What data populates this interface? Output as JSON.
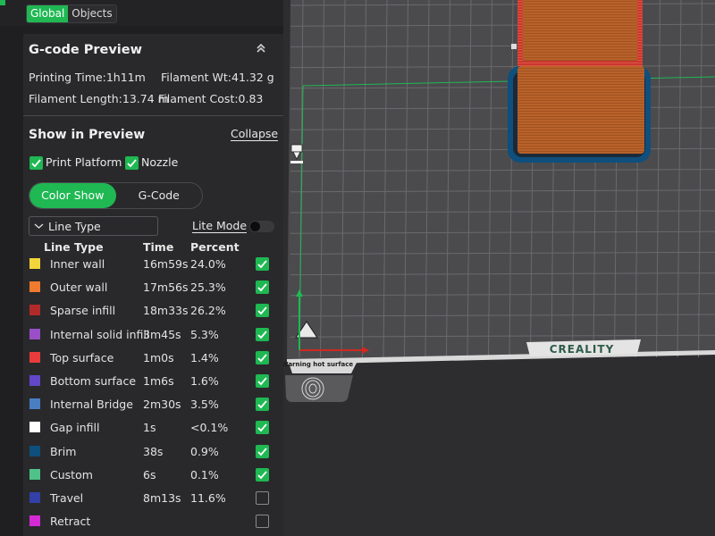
{
  "tabs": [
    {
      "label": "Global",
      "active": true
    },
    {
      "label": "Objects",
      "active": false
    }
  ],
  "gcode_preview": {
    "title": "G-code Preview",
    "collapse_icon": "double-chevron-up-icon",
    "printing_time": "Printing Time:1h11m",
    "filament_weight": "Filament Wt:41.32 g",
    "filament_length": "Filament Length:13.74 m",
    "filament_cost": "Filament Cost:0.83"
  },
  "show_in_preview": {
    "title": "Show in Preview",
    "collapse_label": "Collapse",
    "print_platform_label": "Print Platform",
    "print_platform_checked": true,
    "nozzle_label": "Nozzle",
    "nozzle_checked": true,
    "mode_options": [
      "Color Show",
      "G-Code"
    ],
    "mode_selected": "Color Show",
    "view_select_value": "Line Type",
    "lite_mode_label": "Lite Mode",
    "lite_mode_on": false,
    "columns": {
      "type": "Line Type",
      "time": "Time",
      "percent": "Percent"
    },
    "rows": [
      {
        "type": "Inner wall",
        "time": "16m59s",
        "percent": "24.0%",
        "color": "#f2d53a",
        "checked": true
      },
      {
        "type": "Outer wall",
        "time": "17m56s",
        "percent": "25.3%",
        "color": "#f07a2e",
        "checked": true
      },
      {
        "type": "Sparse infill",
        "time": "18m33s",
        "percent": "26.2%",
        "color": "#b12a2a",
        "checked": true
      },
      {
        "type": "Internal solid infill",
        "time": "3m45s",
        "percent": "5.3%",
        "color": "#9a4fc9",
        "checked": true
      },
      {
        "type": "Top surface",
        "time": "1m0s",
        "percent": "1.4%",
        "color": "#e83c3c",
        "checked": true
      },
      {
        "type": "Bottom surface",
        "time": "1m6s",
        "percent": "1.6%",
        "color": "#6247c8",
        "checked": true
      },
      {
        "type": "Internal Bridge",
        "time": "2m30s",
        "percent": "3.5%",
        "color": "#4a7ec2",
        "checked": true
      },
      {
        "type": "Gap infill",
        "time": "1s",
        "percent": "<0.1%",
        "color": "#ffffff",
        "checked": true
      },
      {
        "type": "Brim",
        "time": "38s",
        "percent": "0.9%",
        "color": "#0e4f7d",
        "checked": true
      },
      {
        "type": "Custom",
        "time": "6s",
        "percent": "0.1%",
        "color": "#4fc28a",
        "checked": true
      },
      {
        "type": "Travel",
        "time": "8m13s",
        "percent": "11.6%",
        "color": "#3240a8",
        "checked": false
      },
      {
        "type": "Retract",
        "time": "",
        "percent": "",
        "color": "#d42ad4",
        "checked": false
      }
    ]
  },
  "viewport": {
    "brand_label": "CREALITY",
    "bed_warning_text": "Warning hot surface",
    "object_color": "#b8622a",
    "brim_color": "#0e4f7d",
    "top_surface_color": "#e83c3c"
  },
  "colors": {
    "accent": "#1fb853",
    "panel": "#1f1f21",
    "card": "#29292b"
  }
}
